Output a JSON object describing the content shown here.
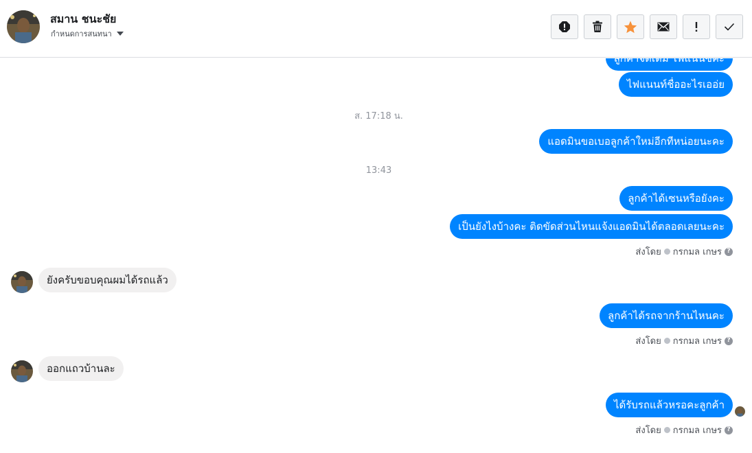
{
  "header": {
    "name": "สมาน ชนะชัย",
    "subtitle": "กำหนดการสนทนา"
  },
  "actions": [
    {
      "name": "report-icon",
      "label": "!"
    },
    {
      "name": "trash-icon"
    },
    {
      "name": "star-icon",
      "color": "#f7923b"
    },
    {
      "name": "mail-icon"
    },
    {
      "name": "important-icon",
      "label": "!"
    },
    {
      "name": "check-icon"
    }
  ],
  "messages": {
    "m0": "ลูกค้าจัดเต็ม ไฟแนนซ์ค่ะ",
    "m1": "ไฟแนนท์ชื่ออะไรเออ่ย",
    "ts1": "ส. 17:18 น.",
    "m2": "แอดมินขอเบอลูกค้าใหม่อีกทีหน่อยนะคะ",
    "ts2": "13:43",
    "m3": "ลูกค้าได้เซนหรือยังคะ",
    "m4": "เป็นยังไงบ้างคะ ติดขัดส่วนไหนแจ้งแอดมินได้ตลอดเลยนะคะ",
    "sent1": "ส่งโดย",
    "sent1_name": "กรกมล เกษร",
    "in1": "ยังครับขอบคุณผมได้รถแล้ว",
    "m5": "ลูกค้าได้รถจากร้านไหนคะ",
    "sent2": "ส่งโดย",
    "sent2_name": "กรกมล เกษร",
    "in2": "ออกแถวบ้านละ",
    "m6": "ได้รับรถแล้วหรอคะลูกค้า",
    "sent3": "ส่งโดย",
    "sent3_name": "กรกมล เกษร"
  },
  "colors": {
    "outgoing": "#0084ff",
    "incoming": "#f1f0f0",
    "star": "#f7923b"
  }
}
